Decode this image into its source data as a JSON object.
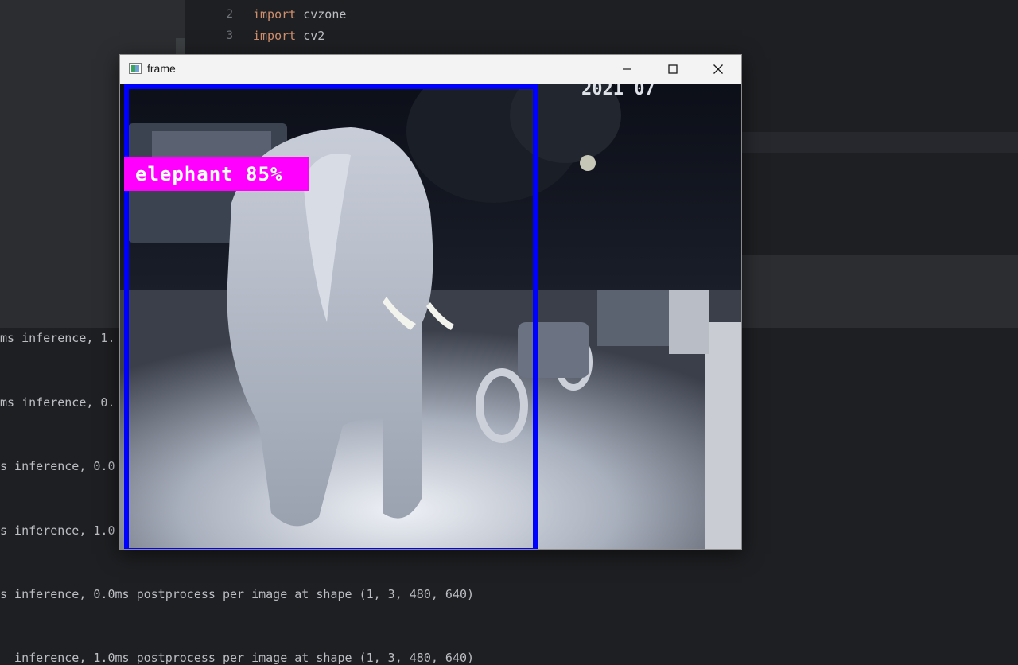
{
  "editor": {
    "lines": [
      {
        "number": "2",
        "keyword": "import",
        "module": " cvzone"
      },
      {
        "number": "3",
        "keyword": "import",
        "module": " cv2"
      }
    ]
  },
  "console": {
    "lines": [
      "ms inference, 1.",
      "ms inference, 0.",
      "s inference, 0.0",
      "s inference, 1.0",
      "s inference, 0.0ms postprocess per image at shape (1, 3, 480, 640)",
      "  inference, 1.0ms postprocess per image at shape (1, 3, 480, 640)"
    ]
  },
  "window": {
    "title": "frame",
    "controls": [
      "minimize-icon",
      "maximize-icon",
      "close-icon"
    ]
  },
  "detection": {
    "label": "elephant 85%",
    "class": "elephant",
    "confidence_percent": 85,
    "box_color": "#0000ff",
    "label_bg_color": "#ff00ff",
    "label_text_color": "#ffffff"
  },
  "camera": {
    "timestamp_fragment": "2021 07"
  }
}
